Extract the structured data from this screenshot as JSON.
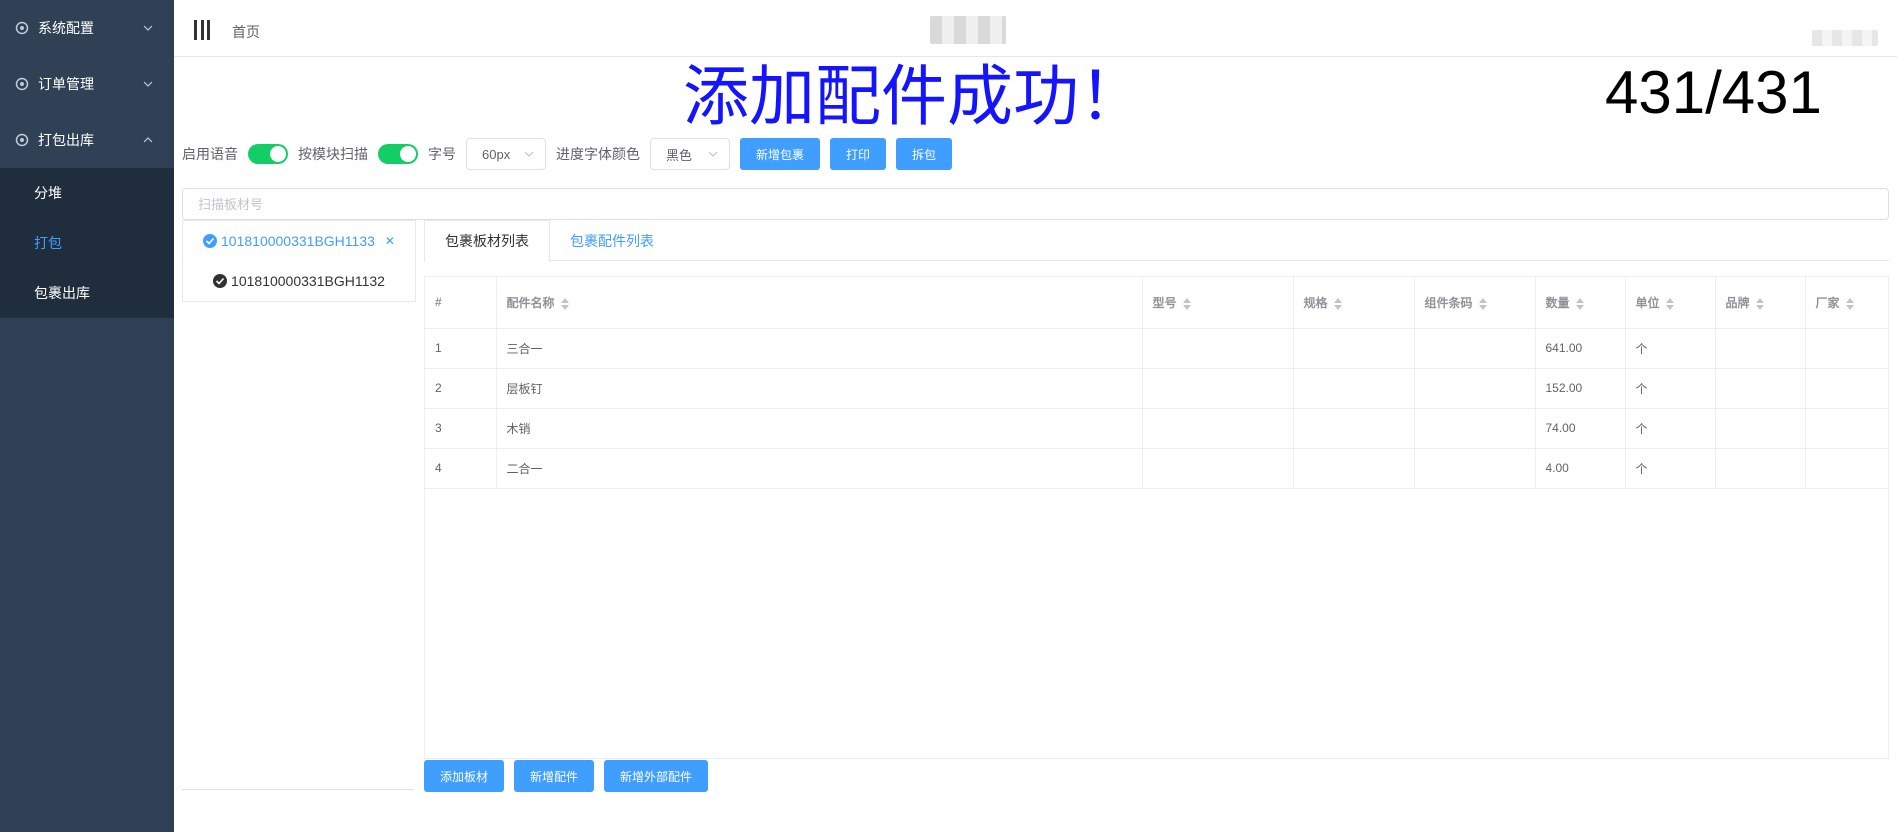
{
  "sidebar": {
    "menus": [
      {
        "label": "系统配置",
        "expanded": false
      },
      {
        "label": "订单管理",
        "expanded": false
      },
      {
        "label": "打包出库",
        "expanded": true
      }
    ],
    "submenu": [
      {
        "label": "分堆",
        "active": false
      },
      {
        "label": "打包",
        "active": true
      },
      {
        "label": "包裹出库",
        "active": false
      }
    ]
  },
  "header": {
    "breadcrumb": "首页"
  },
  "message": {
    "success": "添加配件成功！",
    "progress": "431/431",
    "success_color": "#1414ff"
  },
  "toolbar": {
    "voice_label": "启用语音",
    "voice_on": true,
    "module_scan_label": "按模块扫描",
    "module_scan_on": true,
    "font_size_label": "字号",
    "font_size_value": "60px",
    "font_color_label": "进度字体颜色",
    "font_color_value": "黑色",
    "new_package": "新增包裹",
    "print": "打印",
    "unpack": "拆包"
  },
  "scan": {
    "placeholder": "扫描板材号"
  },
  "boards": [
    {
      "code": "101810000331BGH1133",
      "active": true
    },
    {
      "code": "101810000331BGH1132",
      "active": false
    }
  ],
  "tabs": [
    {
      "label": "包裹板材列表",
      "active": true
    },
    {
      "label": "包裹配件列表",
      "active": false
    }
  ],
  "table": {
    "columns": [
      "#",
      "配件名称",
      "型号",
      "规格",
      "组件条码",
      "数量",
      "单位",
      "品牌",
      "厂家"
    ],
    "rows": [
      [
        "1",
        "三合一",
        "",
        "",
        "",
        "641.00",
        "个",
        "",
        ""
      ],
      [
        "2",
        "层板钉",
        "",
        "",
        "",
        "152.00",
        "个",
        "",
        ""
      ],
      [
        "3",
        "木销",
        "",
        "",
        "",
        "74.00",
        "个",
        "",
        ""
      ],
      [
        "4",
        "二合一",
        "",
        "",
        "",
        "4.00",
        "个",
        "",
        ""
      ]
    ]
  },
  "bottom": {
    "add_board": "添加板材",
    "add_part": "新增配件",
    "add_external_part": "新增外部配件"
  },
  "colors": {
    "sidebar_bg": "#304156",
    "submenu_bg": "#1f2d3d",
    "primary": "#409eff",
    "switch_on": "#13ce66"
  }
}
